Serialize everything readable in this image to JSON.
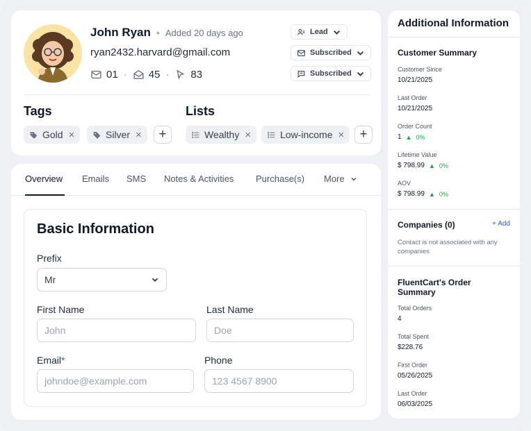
{
  "profile": {
    "name": "John Ryan",
    "added": "Added 20 days ago",
    "email": "ryan2432.harvard@gmail.com",
    "stats": {
      "emails": "01",
      "opened": "45",
      "clicks": "83"
    },
    "status_pills": [
      {
        "label": "Lead",
        "icon": "user-group-icon"
      },
      {
        "label": "Subscribed",
        "icon": "mail-icon"
      },
      {
        "label": "Subscribed",
        "icon": "chat-icon"
      }
    ]
  },
  "tags": {
    "title": "Tags",
    "items": [
      "Gold",
      "Silver"
    ]
  },
  "lists": {
    "title": "Lists",
    "items": [
      "Wealthy",
      "Low-income"
    ]
  },
  "tabs": [
    "Overview",
    "Emails",
    "SMS",
    "Notes & Activities",
    "Purchase(s)",
    "More"
  ],
  "basic_info": {
    "title": "Basic Information",
    "prefix_label": "Prefix",
    "prefix_value": "Mr",
    "first_name_label": "First Name",
    "first_name_placeholder": "John",
    "last_name_label": "Last Name",
    "last_name_placeholder": "Doe",
    "email_label": "Email",
    "email_required": "*",
    "email_placeholder": "johndoe@example.com",
    "phone_label": "Phone",
    "phone_placeholder": "123 4567 8900"
  },
  "side": {
    "title": "Additional Information",
    "summary_title": "Customer Summary",
    "customer_since_label": "Customer Since",
    "customer_since": "10/21/2025",
    "last_order_label": "Last Order",
    "last_order": "10/21/2025",
    "order_count_label": "Order Count",
    "order_count": "1",
    "order_count_change": "0%",
    "lifetime_label": "Lifetime Value",
    "lifetime": "$ 798.99",
    "lifetime_change": "0%",
    "aov_label": "AOV",
    "aov": "$ 798.99",
    "aov_change": "0%",
    "companies_title": "Companies (0)",
    "companies_add": "Add",
    "companies_text": "Contact is not associated with any companies",
    "fluent_title": "FluentCart's Order Summary",
    "total_orders_label": "Total Orders",
    "total_orders": "4",
    "total_spent_label": "Total Spent",
    "total_spent": "$228.76",
    "first_order_label": "First Order",
    "first_order": "05/26/2025",
    "last_order2_label": "Last Order",
    "last_order2": "06/03/2025"
  },
  "colors": {
    "accent": "#2563eb",
    "positive": "#16a34a",
    "chip_bg": "#eef0f3"
  }
}
